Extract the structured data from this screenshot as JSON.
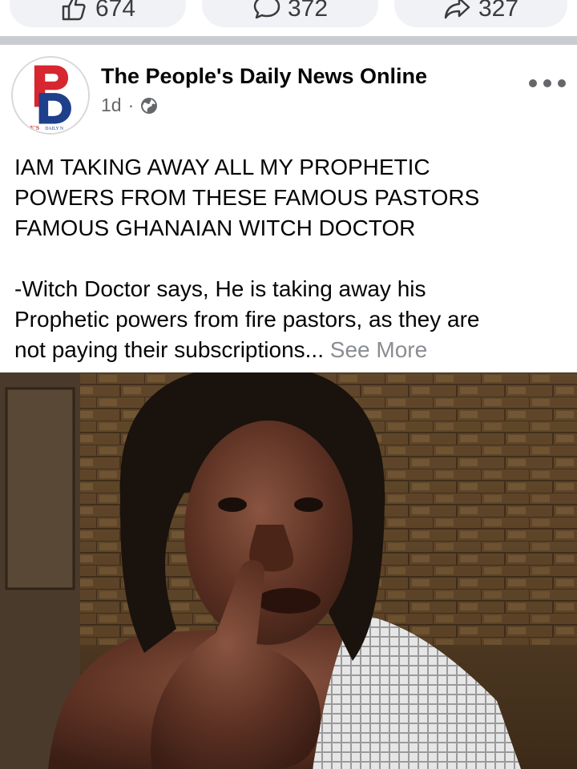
{
  "reactions": {
    "like_count": "674",
    "comment_count": "372",
    "share_count": "327"
  },
  "post": {
    "author": "The People's Daily News Online",
    "time": "1d",
    "separator": "·",
    "logo_text": "PEOPLE'S DAILY NEWS",
    "headline_lines": [
      "IAM TAKING AWAY ALL MY PROPHETIC",
      "POWERS FROM THESE FAMOUS PASTORS",
      "FAMOUS GHANAIAN WITCH DOCTOR"
    ],
    "body_lines": [
      "-Witch Doctor says, He is taking away his",
      "Prophetic powers from fire pastors, as they are",
      "not paying their subscriptions..."
    ],
    "see_more": "See More"
  },
  "icons": {
    "like": "thumbs-up-icon",
    "comment": "comment-icon",
    "share": "share-icon",
    "privacy": "globe-icon",
    "more": "more-dots-icon"
  },
  "colors": {
    "text": "#050505",
    "meta": "#65676b",
    "see_more": "#8a8d91",
    "divider": "#c9ccd1",
    "logo_red": "#d7262f",
    "logo_blue": "#1e3f8a"
  }
}
